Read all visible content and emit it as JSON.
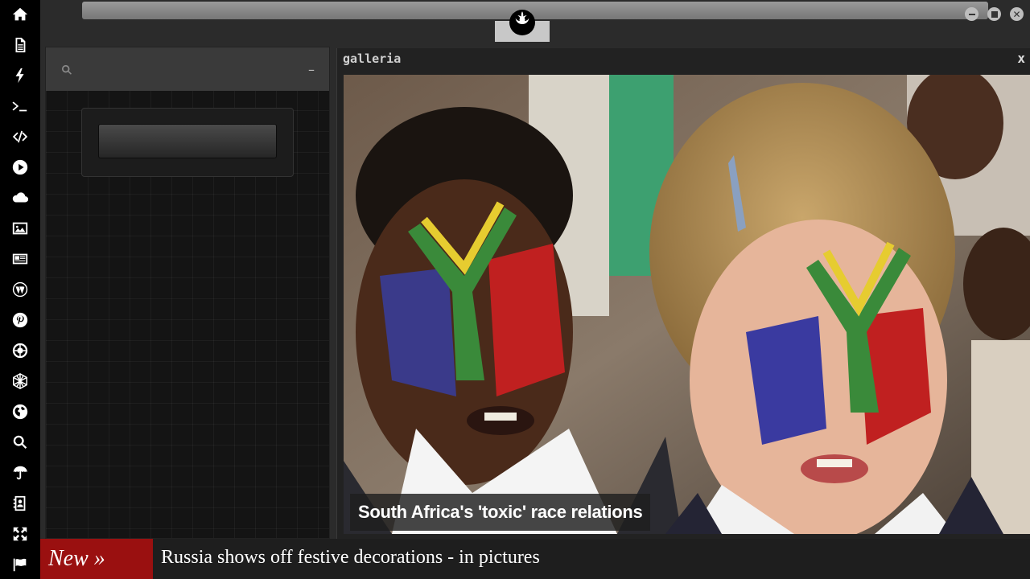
{
  "dock": {
    "items": [
      {
        "name": "home-icon"
      },
      {
        "name": "document-icon"
      },
      {
        "name": "lightning-icon"
      },
      {
        "name": "terminal-icon"
      },
      {
        "name": "code-icon"
      },
      {
        "name": "play-icon"
      },
      {
        "name": "cloud-icon"
      },
      {
        "name": "image-icon"
      },
      {
        "name": "newspaper-icon"
      },
      {
        "name": "wordpress-icon"
      },
      {
        "name": "pinterest-icon"
      },
      {
        "name": "empire-icon"
      },
      {
        "name": "network-icon"
      },
      {
        "name": "globe-icon"
      },
      {
        "name": "search-icon"
      },
      {
        "name": "umbrella-icon"
      },
      {
        "name": "contacts-icon"
      },
      {
        "name": "expand-icon"
      },
      {
        "name": "flag-icon"
      }
    ]
  },
  "topbar": {
    "address_value": "",
    "logo_icon": "rebel-alliance-icon",
    "window_buttons": [
      "minimize-icon",
      "maximize-icon",
      "close-icon"
    ]
  },
  "left_panel": {
    "search_placeholder": "",
    "minimize_label": "–"
  },
  "gallery": {
    "title": "galleria",
    "close_label": "x",
    "caption": "South Africa's 'toxic' race relations"
  },
  "ticker": {
    "badge": "New »",
    "headline": "Russia shows off festive decorations - in pictures"
  },
  "colors": {
    "dock_bg": "#000000",
    "ticker_badge": "#9a1010",
    "panel_bg": "#141414"
  }
}
